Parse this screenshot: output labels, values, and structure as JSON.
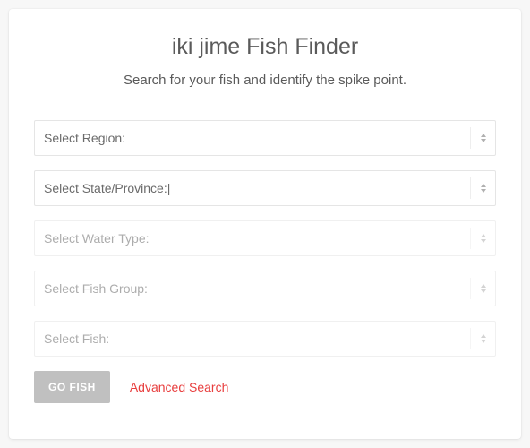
{
  "header": {
    "title": "iki jime Fish Finder",
    "subtitle": "Search for your fish and identify the spike point."
  },
  "selects": {
    "region": {
      "label": "Select Region:",
      "enabled": true
    },
    "state": {
      "label": "Select State/Province:|",
      "enabled": true
    },
    "water_type": {
      "label": "Select Water Type:",
      "enabled": false
    },
    "fish_group": {
      "label": "Select Fish Group:",
      "enabled": false
    },
    "fish": {
      "label": "Select Fish:",
      "enabled": false
    }
  },
  "actions": {
    "go_fish_label": "GO FISH",
    "advanced_search_label": "Advanced Search"
  }
}
